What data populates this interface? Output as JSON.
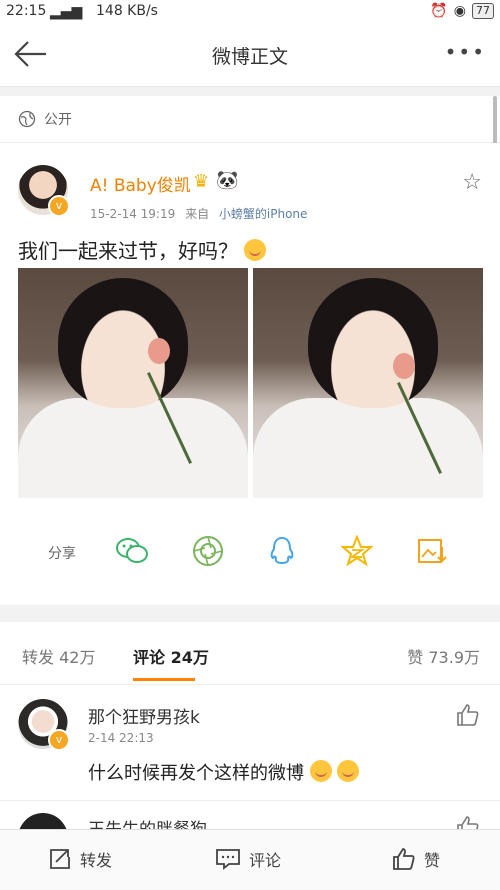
{
  "status_bar": {
    "time": "22:15",
    "speed": "148 KB/s",
    "battery": "77"
  },
  "nav": {
    "title": "微博正文"
  },
  "visibility": {
    "label": "公开"
  },
  "post": {
    "username": "A! Baby俊凯",
    "timestamp": "15-2-14 19:19",
    "source_prefix": "来自",
    "source": "小螃蟹的iPhone",
    "text": "我们一起来过节，好吗？"
  },
  "share": {
    "label": "分享",
    "icons": [
      "wechat-icon",
      "moments-icon",
      "qq-icon",
      "qzone-icon",
      "save-image-icon"
    ]
  },
  "tabs": {
    "repost": "转发 42万",
    "comment": "评论 24万",
    "like": "赞 73.9万"
  },
  "comments": [
    {
      "name": "那个狂野男孩k",
      "time": "2-14 22:13",
      "text": "什么时候再发个这样的微博"
    },
    {
      "name": "王先生的胖餐狗",
      "time": "",
      "text": ""
    }
  ],
  "bottom_bar": {
    "repost": "转发",
    "comment": "评论",
    "like": "赞"
  },
  "colors": {
    "accent": "#ff8200",
    "username": "#f08200",
    "source": "#5b7ea3"
  }
}
